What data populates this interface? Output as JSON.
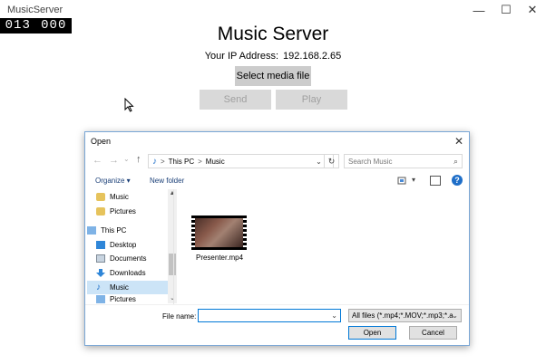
{
  "app": {
    "title": "MusicServer",
    "window_controls": {
      "minimize": "—",
      "maximize": "☐",
      "close": "✕"
    },
    "counter": {
      "left": "013",
      "right": "000"
    },
    "heading": "Music Server",
    "ip_label": "Your IP Address:",
    "ip_value": "192.168.2.65",
    "buttons": {
      "select_media": "Select media file",
      "send": "Send",
      "play": "Play"
    }
  },
  "dialog": {
    "title": "Open",
    "close": "✕",
    "nav": {
      "back": "←",
      "forward": "→",
      "recent": "⌄",
      "up": "↑"
    },
    "address": {
      "music_note": "♪",
      "sep1": ">",
      "this_pc": "This PC",
      "sep2": ">",
      "music": "Music",
      "dropdown": "⌄",
      "refresh": "↻"
    },
    "search_placeholder": "Search Music",
    "search_icon": "⌕",
    "toolbar": {
      "organize": "Organize ▾",
      "new_folder": "New folder",
      "view_chevron": "▾",
      "help": "?"
    },
    "nav_items": [
      {
        "label": "Music",
        "icon": "music-quick-icon"
      },
      {
        "label": "Pictures",
        "icon": "pictures-quick-icon"
      },
      {
        "label": "This PC",
        "icon": "pc-icon"
      },
      {
        "label": "Desktop",
        "icon": "desktop-icon"
      },
      {
        "label": "Documents",
        "icon": "documents-icon"
      },
      {
        "label": "Downloads",
        "icon": "downloads-icon"
      },
      {
        "label": "Music",
        "icon": "music-note-icon"
      },
      {
        "label": "Pictures",
        "icon": "pictures-icon"
      }
    ],
    "scroll": {
      "up": "▲",
      "down": "⌄"
    },
    "files": [
      {
        "name": "Presenter.mp4"
      }
    ],
    "file_name_label": "File name:",
    "file_name_value": "",
    "file_name_dropdown": "⌄",
    "filter": "All files (*.mp4;*.MOV;*.mp3;*.a",
    "filter_chevron": "⌄",
    "open_label": "Open",
    "cancel_label": "Cancel"
  },
  "colors": {
    "accent": "#0078d7",
    "selection": "#cce4f7",
    "button": "#cccccc"
  }
}
